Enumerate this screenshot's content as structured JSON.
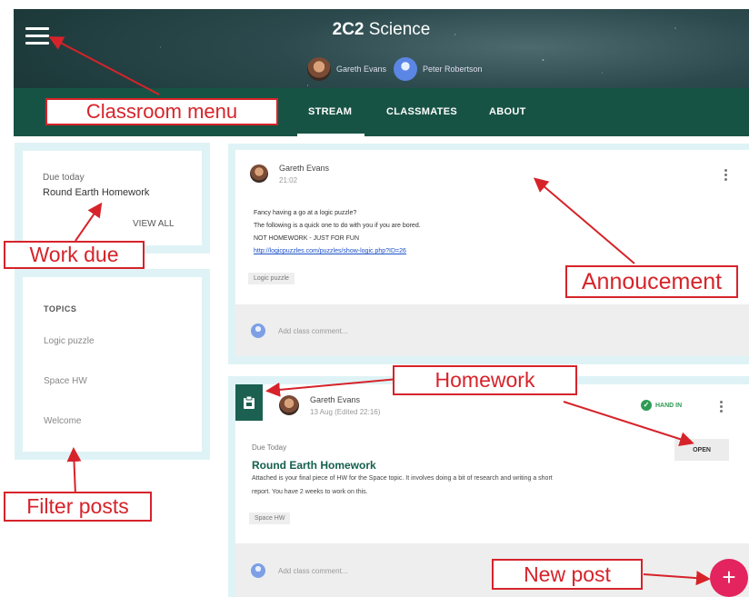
{
  "header": {
    "menu_icon": "hamburger-menu-icon",
    "class_title_bold": "2C2",
    "class_title_rest": " Science",
    "teachers": [
      {
        "name": "Gareth Evans",
        "avatar": "photo"
      },
      {
        "name": "Peter Robertson",
        "avatar": "blue-person-icon"
      }
    ]
  },
  "tabs": [
    {
      "label": "STREAM",
      "active": true
    },
    {
      "label": "CLASSMATES",
      "active": false
    },
    {
      "label": "ABOUT",
      "active": false
    }
  ],
  "due_card": {
    "label": "Due today",
    "item": "Round Earth Homework",
    "view_all": "VIEW ALL"
  },
  "topics_card": {
    "heading": "TOPICS",
    "items": [
      "Logic puzzle",
      "Space HW",
      "Welcome"
    ]
  },
  "announcement": {
    "author": "Gareth Evans",
    "time": "21:02",
    "lines": [
      "Fancy having a go at a logic puzzle?",
      "The following is a quick one to do with you if you are bored.",
      "NOT HOMEWORK - JUST FOR FUN"
    ],
    "link": "http://logicpuzzles.com/puzzles/show-logic.php?ID=26",
    "topic_chip": "Logic puzzle",
    "comment_placeholder": "Add class comment..."
  },
  "homework": {
    "icon": "assignment-icon",
    "author": "Gareth Evans",
    "time": "13 Aug (Edited 22:16)",
    "status": "HAND IN",
    "due": "Due Today",
    "title": "Round Earth Homework",
    "desc_lines": [
      "Attached is your final piece of HW for the Space topic. It involves doing a bit of research and writing a short",
      "report. You have 2 weeks to work on this."
    ],
    "topic_chip": "Space HW",
    "open_label": "OPEN",
    "comment_placeholder": "Add class comment..."
  },
  "fab_label": "+",
  "callouts": {
    "classroom_menu": "Classroom menu",
    "work_due": "Work due",
    "filter_posts": "Filter posts",
    "announcement": "Annoucement",
    "homework": "Homework",
    "new_post": "New post"
  },
  "colors": {
    "header_dark": "#175344",
    "accent_green": "#14604e",
    "callout_red": "#d6232a",
    "fab_pink": "#e3245e",
    "panel_tint": "#dff3f6"
  }
}
